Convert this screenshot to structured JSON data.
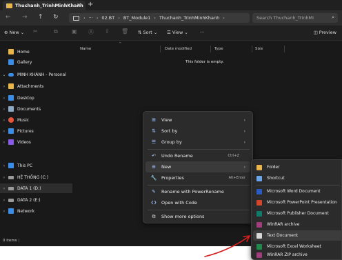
{
  "tab": {
    "title": "Thuchanh_TrinhMinhKhanh"
  },
  "address": {
    "more": "···",
    "segments": [
      "02.BT",
      "BT_Module1",
      "Thuchanh_TrinhMinhKhanh"
    ],
    "search_placeholder": "Search Thuchanh_TrinhMi"
  },
  "toolbar": {
    "new_label": "New",
    "sort_label": "Sort",
    "view_label": "View",
    "more": "···",
    "preview_label": "Preview"
  },
  "sidebar": {
    "items": [
      {
        "label": "Home",
        "icon": "home-icon",
        "color": "#e8b54b",
        "chevron": ""
      },
      {
        "label": "Gallery",
        "icon": "gallery-icon",
        "color": "#3b8ee8",
        "chevron": ""
      },
      {
        "label": "MINH KHÁNH - Personal",
        "icon": "onedrive-icon",
        "color": "#3b8ee8",
        "chevron": ""
      },
      {
        "label": "Attachments",
        "icon": "folder-icon",
        "color": "#e8b54b",
        "chevron": "›"
      },
      {
        "label": "Desktop",
        "icon": "desktop-icon",
        "color": "#3b8ee8",
        "chevron": "›"
      },
      {
        "label": "Documents",
        "icon": "documents-icon",
        "color": "#8fa8c8",
        "chevron": "›"
      },
      {
        "label": "Music",
        "icon": "music-icon",
        "color": "#e8553b",
        "chevron": "›"
      },
      {
        "label": "Pictures",
        "icon": "pictures-icon",
        "color": "#3b8ee8",
        "chevron": "›"
      },
      {
        "label": "Videos",
        "icon": "videos-icon",
        "color": "#8a5be8",
        "chevron": "›"
      },
      {
        "label": "This PC",
        "icon": "pc-icon",
        "color": "#3b8ee8",
        "chevron": "›"
      },
      {
        "label": "HỆ THỐNG (C:)",
        "icon": "drive-icon",
        "color": "#9a9a9a",
        "chevron": "›"
      },
      {
        "label": "DATA 1 (D:)",
        "icon": "drive-icon",
        "color": "#9a9a9a",
        "chevron": "›"
      },
      {
        "label": "DATA 2 (E:)",
        "icon": "drive-icon",
        "color": "#9a9a9a",
        "chevron": "›"
      },
      {
        "label": "Network",
        "icon": "network-icon",
        "color": "#3b8ee8",
        "chevron": "›"
      }
    ]
  },
  "filelist": {
    "columns": [
      "Name",
      "Date modified",
      "Type",
      "Size"
    ],
    "empty_text": "This folder is empty."
  },
  "status": {
    "text": "0 items"
  },
  "context_menu": {
    "items": [
      {
        "label": "View",
        "icon": "grid-icon",
        "glyph": "⊞",
        "shortcut": "",
        "arrow": "›"
      },
      {
        "label": "Sort by",
        "icon": "sort-icon",
        "glyph": "⇅",
        "shortcut": "",
        "arrow": "›"
      },
      {
        "label": "Group by",
        "icon": "group-icon",
        "glyph": "☰",
        "shortcut": "",
        "arrow": "›"
      },
      {
        "label": "Undo Rename",
        "icon": "undo-icon",
        "glyph": "↶",
        "shortcut": "Ctrl+Z",
        "arrow": ""
      },
      {
        "label": "New",
        "icon": "new-icon",
        "glyph": "⊕",
        "shortcut": "",
        "arrow": "›"
      },
      {
        "label": "Properties",
        "icon": "properties-icon",
        "glyph": "🔧",
        "shortcut": "Alt+Enter",
        "arrow": ""
      },
      {
        "label": "Rename with PowerRename",
        "icon": "powerrename-icon",
        "glyph": "✎",
        "shortcut": "",
        "arrow": ""
      },
      {
        "label": "Open with Code",
        "icon": "vscode-icon",
        "glyph": "❮❯",
        "shortcut": "",
        "arrow": ""
      },
      {
        "label": "Show more options",
        "icon": "more-options-icon",
        "glyph": "⧉",
        "shortcut": "",
        "arrow": ""
      }
    ]
  },
  "new_submenu": {
    "items": [
      {
        "label": "Folder",
        "icon": "folder-icon",
        "color": "#e8b54b"
      },
      {
        "label": "Shortcut",
        "icon": "shortcut-icon",
        "color": "#6aa6e8"
      },
      {
        "label": "Microsoft Word Document",
        "icon": "word-icon",
        "color": "#2b5bbf"
      },
      {
        "label": "Microsoft PowerPoint Presentation",
        "icon": "powerpoint-icon",
        "color": "#d2472b"
      },
      {
        "label": "Microsoft Publisher Document",
        "icon": "publisher-icon",
        "color": "#127a6b"
      },
      {
        "label": "WinRAR archive",
        "icon": "winrar-icon",
        "color": "#a03c7a"
      },
      {
        "label": "Text Document",
        "icon": "text-document-icon",
        "color": "#d8d8d8"
      },
      {
        "label": "Microsoft Excel Worksheet",
        "icon": "excel-icon",
        "color": "#1f8a4c"
      },
      {
        "label": "WinRAR ZIP archive",
        "icon": "winrar-zip-icon",
        "color": "#a03c7a"
      }
    ]
  }
}
